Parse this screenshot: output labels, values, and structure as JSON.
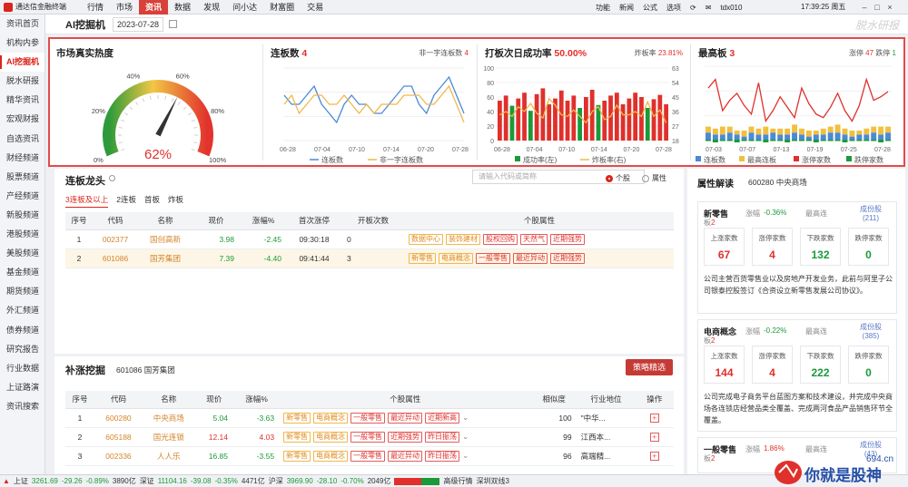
{
  "app": {
    "name": "通达信金融终端",
    "menu": [
      "行情",
      "市场",
      "资讯",
      "数据",
      "发现",
      "问小达",
      "财富圈",
      "交易"
    ],
    "active_menu": "资讯",
    "right_menu": [
      "功能",
      "新闻",
      "公式",
      "选项"
    ],
    "user": "tdx010",
    "time": "17:39:25 周五"
  },
  "sidebar": [
    "资讯首页",
    "机构内参",
    "AI挖掘机",
    "脱水研报",
    "精华资讯",
    "宏观财报",
    "自选资讯",
    "财经频道",
    "股票频道",
    "产经频道",
    "新股频道",
    "港股频道",
    "美股频道",
    "基金频道",
    "期货频道",
    "外汇频道",
    "债券频道",
    "研究报告",
    "行业数据",
    "上证路演",
    "资讯搜索"
  ],
  "sidebar_active": "AI挖掘机",
  "header": {
    "title": "AI挖掘机",
    "date": "2023-07-28",
    "watermark": "脱水研报"
  },
  "heat": {
    "title": "市场真实热度",
    "value": "62%",
    "value_num": 62,
    "ticks": [
      "0%",
      "20%",
      "40%",
      "60%",
      "80%",
      "100%"
    ]
  },
  "lianban": {
    "title": "连板数",
    "count": "4",
    "right_label": "非一字连板数",
    "right_value": "4",
    "chart_data": {
      "type": "line",
      "x": [
        "06-28",
        "07-04",
        "07-10",
        "07-14",
        "07-20",
        "07-28"
      ],
      "ylim": [
        0,
        8
      ],
      "series": [
        {
          "name": "连板数",
          "color": "#4a8ad6",
          "values": [
            5,
            4,
            4,
            5,
            6,
            4,
            3,
            2,
            4,
            5,
            4,
            4,
            3,
            3,
            4,
            5,
            6,
            6,
            4,
            3,
            5,
            6,
            7,
            5,
            3
          ]
        },
        {
          "name": "非一字连板数",
          "color": "#f0b84a",
          "values": [
            4,
            5,
            3,
            4,
            5,
            5,
            4,
            4,
            5,
            4,
            3,
            4,
            3,
            4,
            4,
            4,
            5,
            5,
            5,
            4,
            4,
            5,
            6,
            4,
            2
          ]
        }
      ]
    }
  },
  "success": {
    "title": "打板次日成功率",
    "value": "50.00%",
    "right_label": "炸板率",
    "right_value": "23.81%",
    "chart_data": {
      "type": "bar",
      "x": [
        "06-28",
        "07-04",
        "07-10",
        "07-14",
        "07-20",
        "07-28"
      ],
      "y_left": [
        "100",
        "80",
        "60",
        "40",
        "20",
        "0"
      ],
      "y_right": [
        "63",
        "54",
        "45",
        "36",
        "27",
        "18"
      ],
      "series": [
        {
          "name": "成功率(左)",
          "color": "#1a9a3a",
          "color2": "#e0302c",
          "values": [
            55,
            62,
            48,
            58,
            66,
            41,
            64,
            72,
            50,
            58,
            69,
            55,
            62,
            45,
            60,
            70,
            49,
            55,
            62,
            66,
            50,
            58,
            66,
            60,
            45,
            57,
            63,
            50
          ]
        },
        {
          "name": "炸板率(右)",
          "color": "#f0b84a",
          "values": [
            34,
            36,
            33,
            39,
            36,
            41,
            35,
            32,
            44,
            40,
            34,
            33,
            37,
            33,
            29,
            36,
            39,
            31,
            33,
            40,
            34,
            34,
            36,
            33,
            42,
            33,
            37,
            29
          ]
        }
      ]
    }
  },
  "highest": {
    "title": "最高板",
    "count": "3",
    "up_label": "涨停",
    "up_value": "47",
    "down_label": "跌停",
    "down_value": "1",
    "chart_data": {
      "type": "bar",
      "x": [
        "07-03",
        "07-07",
        "07-13",
        "07-19",
        "07-25",
        "07-28"
      ],
      "series": [
        {
          "name": "连板数",
          "color": "#4a8ad6",
          "values": [
            4,
            3,
            3,
            4,
            3,
            2,
            4,
            3,
            3,
            4,
            3,
            3,
            4,
            3,
            2,
            3,
            3,
            4,
            4,
            3,
            2,
            3,
            3,
            4,
            3,
            4
          ]
        },
        {
          "name": "最高连板",
          "color": "#f0c040",
          "values": [
            3,
            3,
            4,
            3,
            2,
            3,
            3,
            3,
            4,
            2,
            3,
            3,
            4,
            3,
            3,
            2,
            3,
            3,
            4,
            3,
            3,
            2,
            3,
            3,
            4,
            3
          ]
        },
        {
          "name": "涨停家数",
          "color": "#e0302c",
          "values": [
            55,
            60,
            42,
            48,
            52,
            45,
            40,
            58,
            36,
            42,
            50,
            44,
            38,
            55,
            46,
            40,
            38,
            44,
            52,
            42,
            36,
            45,
            60,
            48,
            50,
            53
          ]
        },
        {
          "name": "跌停家数",
          "color": "#1a9a3a",
          "values": [
            1,
            2,
            1,
            1,
            2,
            1,
            1,
            1,
            2,
            1,
            1,
            2,
            1,
            1,
            1,
            2,
            1,
            1,
            1,
            2,
            1,
            1,
            1,
            1,
            2,
            1
          ]
        }
      ]
    }
  },
  "lead": {
    "title": "连板龙头",
    "search_placeholder": "请输入代码或简称",
    "radio_stock": "个股",
    "radio_attr": "属性",
    "tabs": [
      "3连板及以上",
      "2连板",
      "首板",
      "炸板"
    ],
    "active_tab": "3连板及以上",
    "headers": [
      "序号",
      "代码",
      "名称",
      "现价",
      "涨幅%",
      "首次涨停",
      "开板次数",
      "个股属性"
    ],
    "rows": [
      {
        "idx": "1",
        "code": "002377",
        "name": "国创高新",
        "price": "3.98",
        "chg": "-2.45",
        "first": "09:30:18",
        "open": "0",
        "tags": [
          "数据中心",
          "装饰建材",
          "股权回购",
          "天然气",
          "近期强势"
        ]
      },
      {
        "idx": "2",
        "code": "601086",
        "name": "国芳集团",
        "price": "7.39",
        "chg": "-4.40",
        "first": "09:41:44",
        "open": "3",
        "tags": [
          "新零售",
          "电商概念",
          "一般零售",
          "最近异动",
          "近期强势"
        ]
      }
    ]
  },
  "fill": {
    "title": "补涨挖掘",
    "subtitle": "601086 国芳集团",
    "button": "策略精选",
    "headers": [
      "序号",
      "代码",
      "名称",
      "现价",
      "涨幅%",
      "个股属性",
      "相似度",
      "行业地位",
      "操作"
    ],
    "rows": [
      {
        "idx": "1",
        "code": "600280",
        "name": "中央商场",
        "price": "5.04",
        "chg": "-3.63",
        "tags": [
          "新零售",
          "电商概念",
          "一般零售",
          "最近异动",
          "近期新高"
        ],
        "sim": "100",
        "pos": "\"中华..."
      },
      {
        "idx": "2",
        "code": "605188",
        "name": "国光连锁",
        "price": "12.14",
        "chg": "4.03",
        "tags": [
          "新零售",
          "电商概念",
          "一般零售",
          "近期强势",
          "昨日振荡"
        ],
        "sim": "99",
        "pos": "江西本..."
      },
      {
        "idx": "3",
        "code": "002336",
        "name": "人人乐",
        "price": "16.85",
        "chg": "-3.55",
        "tags": [
          "新零售",
          "电商概念",
          "一般零售",
          "最近异动",
          "昨日振荡"
        ],
        "sim": "96",
        "pos": "高端精..."
      }
    ]
  },
  "attr": {
    "title": "属性解读",
    "code": "600280 中央商场",
    "cards": [
      {
        "name": "新零售",
        "chg_label": "涨幅",
        "chg": "-0.36%",
        "high_label": "最高连",
        "high": "",
        "comp_label": "成份股",
        "comp": "(211)",
        "boards_label": "板",
        "boards": "2",
        "stats": [
          {
            "k": "上涨家数",
            "v": "67",
            "c": "#e0302c"
          },
          {
            "k": "涨停家数",
            "v": "4",
            "c": "#e0302c"
          },
          {
            "k": "下跌家数",
            "v": "132",
            "c": "#1a9a3a"
          },
          {
            "k": "跌停家数",
            "v": "0",
            "c": "#1a9a3a"
          }
        ],
        "desc": "公司主营百货零售业以及房地产开发业务，此前与阿里子公司银泰控股签订《合资设立新零售发展公司协议》。"
      },
      {
        "name": "电商概念",
        "chg_label": "涨幅",
        "chg": "-0.22%",
        "high_label": "最高连",
        "high": "",
        "comp_label": "成份股",
        "comp": "(385)",
        "boards_label": "板",
        "boards": "2",
        "stats": [
          {
            "k": "上涨家数",
            "v": "144",
            "c": "#e0302c"
          },
          {
            "k": "涨停家数",
            "v": "4",
            "c": "#e0302c"
          },
          {
            "k": "下跌家数",
            "v": "222",
            "c": "#1a9a3a"
          },
          {
            "k": "跌停家数",
            "v": "0",
            "c": "#1a9a3a"
          }
        ],
        "desc": "公司完成电子商务平台蓝图方案和技术建设，并完成中央商场各连锁店经营品类全覆盖、完成两河食品产品销售环节全覆盖。"
      },
      {
        "name": "一般零售",
        "chg_label": "涨幅",
        "chg": "1.86%",
        "high_label": "最高连",
        "high": "",
        "comp_label": "成份股",
        "comp": "(43)",
        "boards_label": "板",
        "boards": "2",
        "stats": [],
        "desc": ""
      }
    ]
  },
  "status": {
    "sh_label": "上证",
    "sh": "3261.69",
    "sh_chg": "-29.26",
    "sh_pct": "-0.89%",
    "sh_amt": "3890亿",
    "sz_label": "深证",
    "sz": "11104.16",
    "sz_chg": "-39.08",
    "sz_pct": "-0.35%",
    "sz_amt": "4471亿",
    "hs_label": "沪深",
    "hs": "3969.90",
    "hs_chg": "-28.10",
    "hs_pct": "-0.70%",
    "hs_amt": "2049亿",
    "mode": "高级行情",
    "server": "深圳双线3",
    "site": "694.cn",
    "slogan": "你就是股神"
  }
}
